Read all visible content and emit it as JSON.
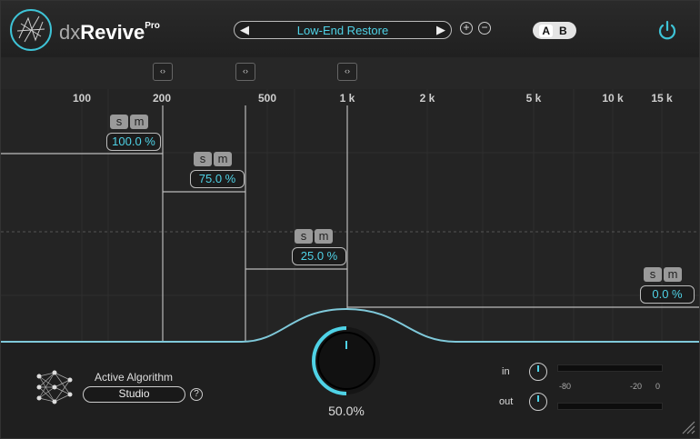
{
  "header": {
    "brand_prefix": "dx",
    "brand_name": "Revive",
    "brand_suffix": "Pro",
    "preset_name": "Low-End Restore",
    "prev_glyph": "◀",
    "next_glyph": "▶",
    "add_glyph": "+",
    "remove_glyph": "−",
    "ab": [
      "A",
      "B"
    ],
    "power_icon": "power-icon"
  },
  "graph": {
    "freq_ticks": [
      "100",
      "200",
      "500",
      "1 k",
      "2 k",
      "5 k",
      "10 k",
      "15 k"
    ],
    "handle_glyph": "‹›",
    "bands": [
      {
        "solo": "s",
        "mute": "m",
        "amount": "100.0 %"
      },
      {
        "solo": "s",
        "mute": "m",
        "amount": "75.0 %"
      },
      {
        "solo": "s",
        "mute": "m",
        "amount": "25.0 %"
      },
      {
        "solo": "s",
        "mute": "m",
        "amount": "0.0 %"
      }
    ]
  },
  "bottom": {
    "algorithm_label": "Active Algorithm",
    "algorithm_value": "Studio",
    "help_glyph": "?",
    "knob_value": "50.0%",
    "in_label": "in",
    "out_label": "out",
    "meter_scale": [
      "-80",
      "-20",
      "0"
    ]
  },
  "colors": {
    "accent": "#4fd2e6"
  }
}
